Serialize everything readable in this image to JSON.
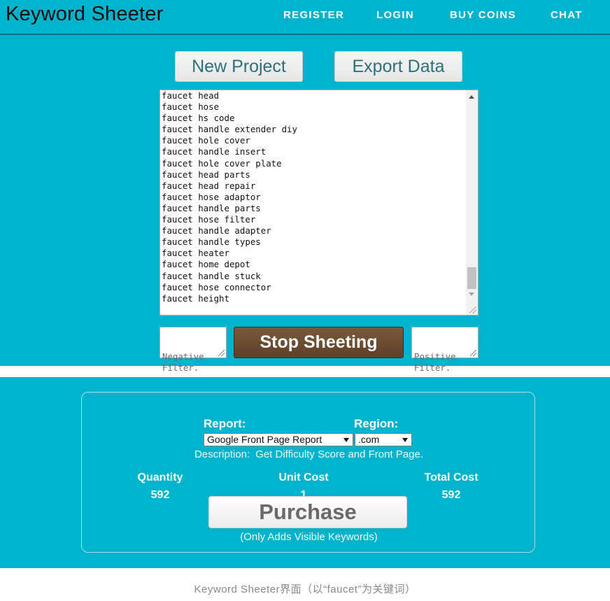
{
  "header": {
    "logo": "Keyword Sheeter",
    "nav": [
      "REGISTER",
      "LOGIN",
      "BUY COINS",
      "CHAT"
    ]
  },
  "toolbar": {
    "new_project": "New Project",
    "export_data": "Export Data"
  },
  "keywords": [
    "faucet head",
    "faucet hose",
    "faucet hs code",
    "faucet handle extender diy",
    "faucet hole cover",
    "faucet handle insert",
    "faucet hole cover plate",
    "faucet head parts",
    "faucet head repair",
    "faucet hose adaptor",
    "faucet handle parts",
    "faucet hose filter",
    "faucet handle adapter",
    "faucet handle types",
    "faucet heater",
    "faucet home depot",
    "faucet handle stuck",
    "faucet hose connector",
    "faucet height"
  ],
  "filters": {
    "negative_placeholder": "Negative Filter.",
    "positive_placeholder": "Positive Filter."
  },
  "stop_button": "Stop Sheeting",
  "purchase": {
    "report_label": "Report:",
    "region_label": "Region:",
    "report_selected": "Google Front Page Report",
    "region_selected": ".com",
    "description_label": "Description:",
    "description_text": "Get Difficulty Score and Front Page.",
    "quantity_label": "Quantity",
    "quantity_value": "592",
    "unit_cost_label": "Unit Cost",
    "unit_cost_value": "1",
    "total_cost_label": "Total Cost",
    "total_cost_value": "592",
    "purchase_button": "Purchase",
    "note": "(Only Adds Visible Keywords)"
  },
  "caption": "Keyword Sheeter界面（以“faucet”为关键词）"
}
